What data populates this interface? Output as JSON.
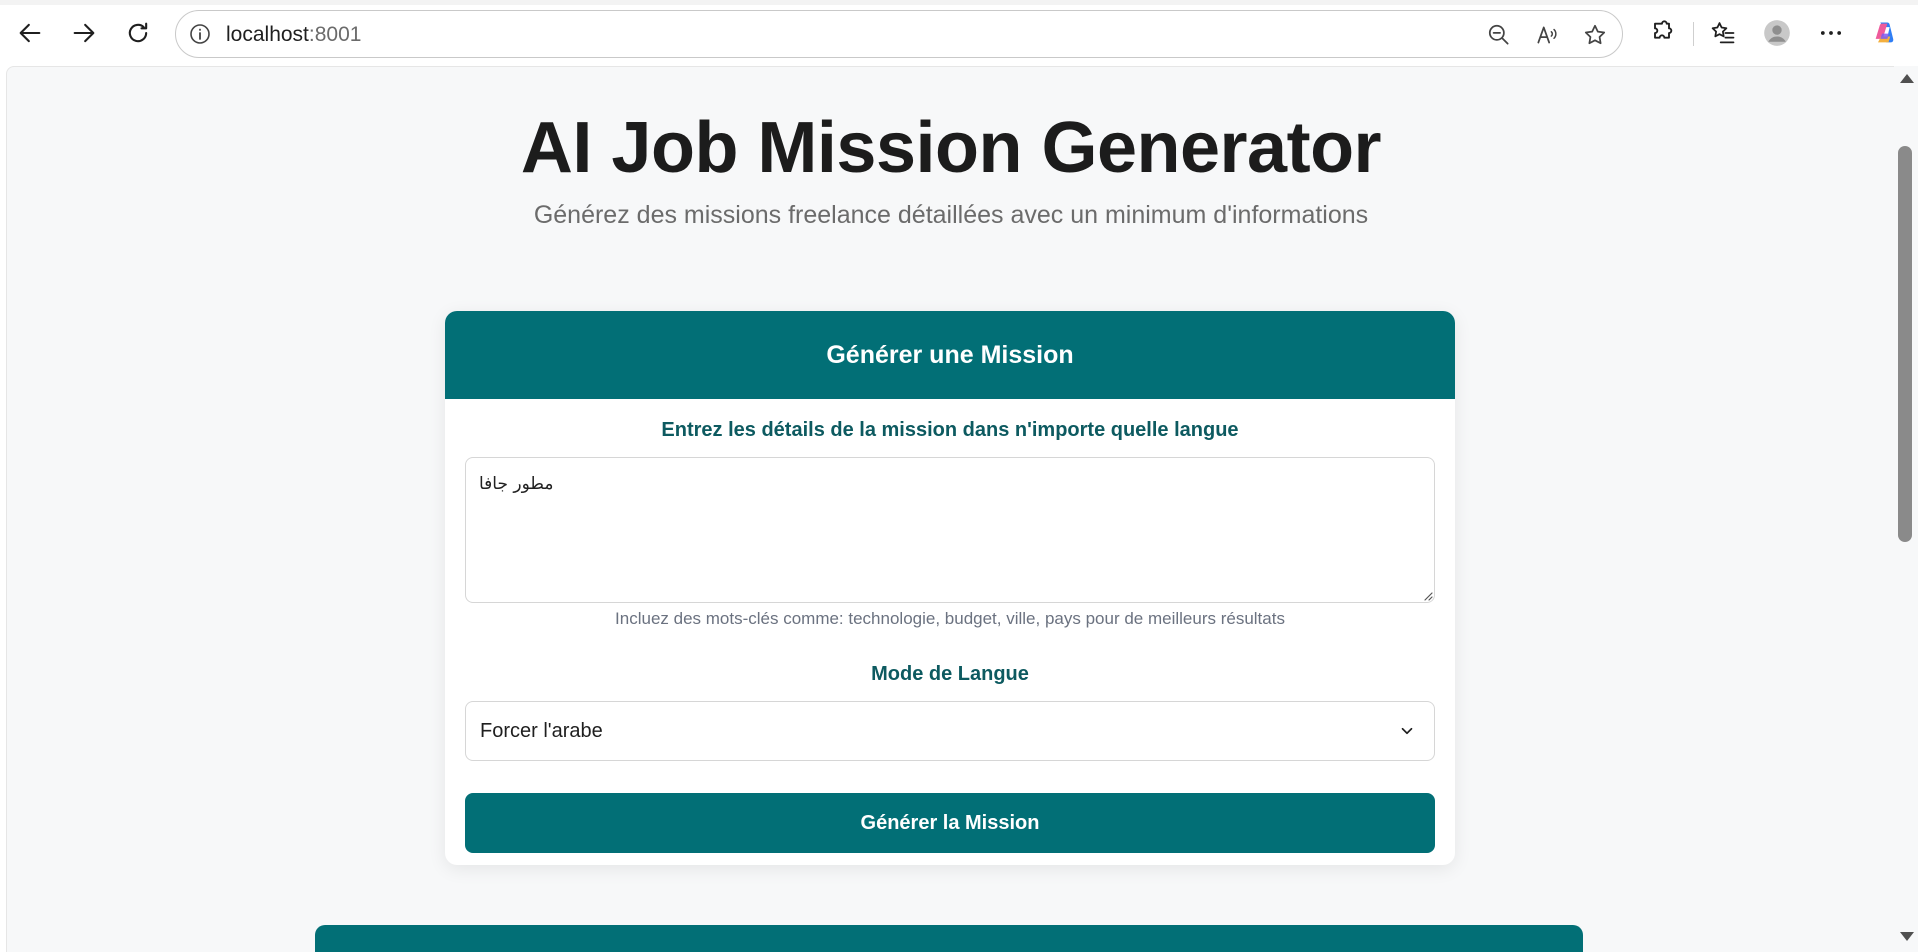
{
  "browser": {
    "url_host": "localhost",
    "url_port": ":8001",
    "icons": {
      "back": "back-arrow-icon",
      "forward": "forward-arrow-icon",
      "refresh": "refresh-icon",
      "site_info": "info-icon",
      "zoom": "zoom-out-icon",
      "read_aloud": "read-aloud-icon",
      "favorite": "star-icon",
      "extensions": "puzzle-icon",
      "favorites": "favorites-list-icon",
      "profile": "avatar-icon",
      "more": "more-dots-icon",
      "copilot": "copilot-icon"
    }
  },
  "header": {
    "title": "AI Job Mission Generator",
    "subtitle": "Générez des missions freelance détaillées avec un minimum d'informations"
  },
  "form_card": {
    "title": "Générer une Mission",
    "details_label": "Entrez les détails de la mission dans n'importe quelle langue",
    "details_value": "مطور جافا",
    "hint": "Incluez des mots-clés comme: technologie, budget, ville, pays pour de meilleurs résultats",
    "language_label": "Mode de Langue",
    "language_selected": "Forcer l'arabe",
    "submit_label": "Générer la Mission"
  },
  "colors": {
    "accent": "#026f76",
    "label": "#0d5a60",
    "background": "#f7f8f9"
  }
}
